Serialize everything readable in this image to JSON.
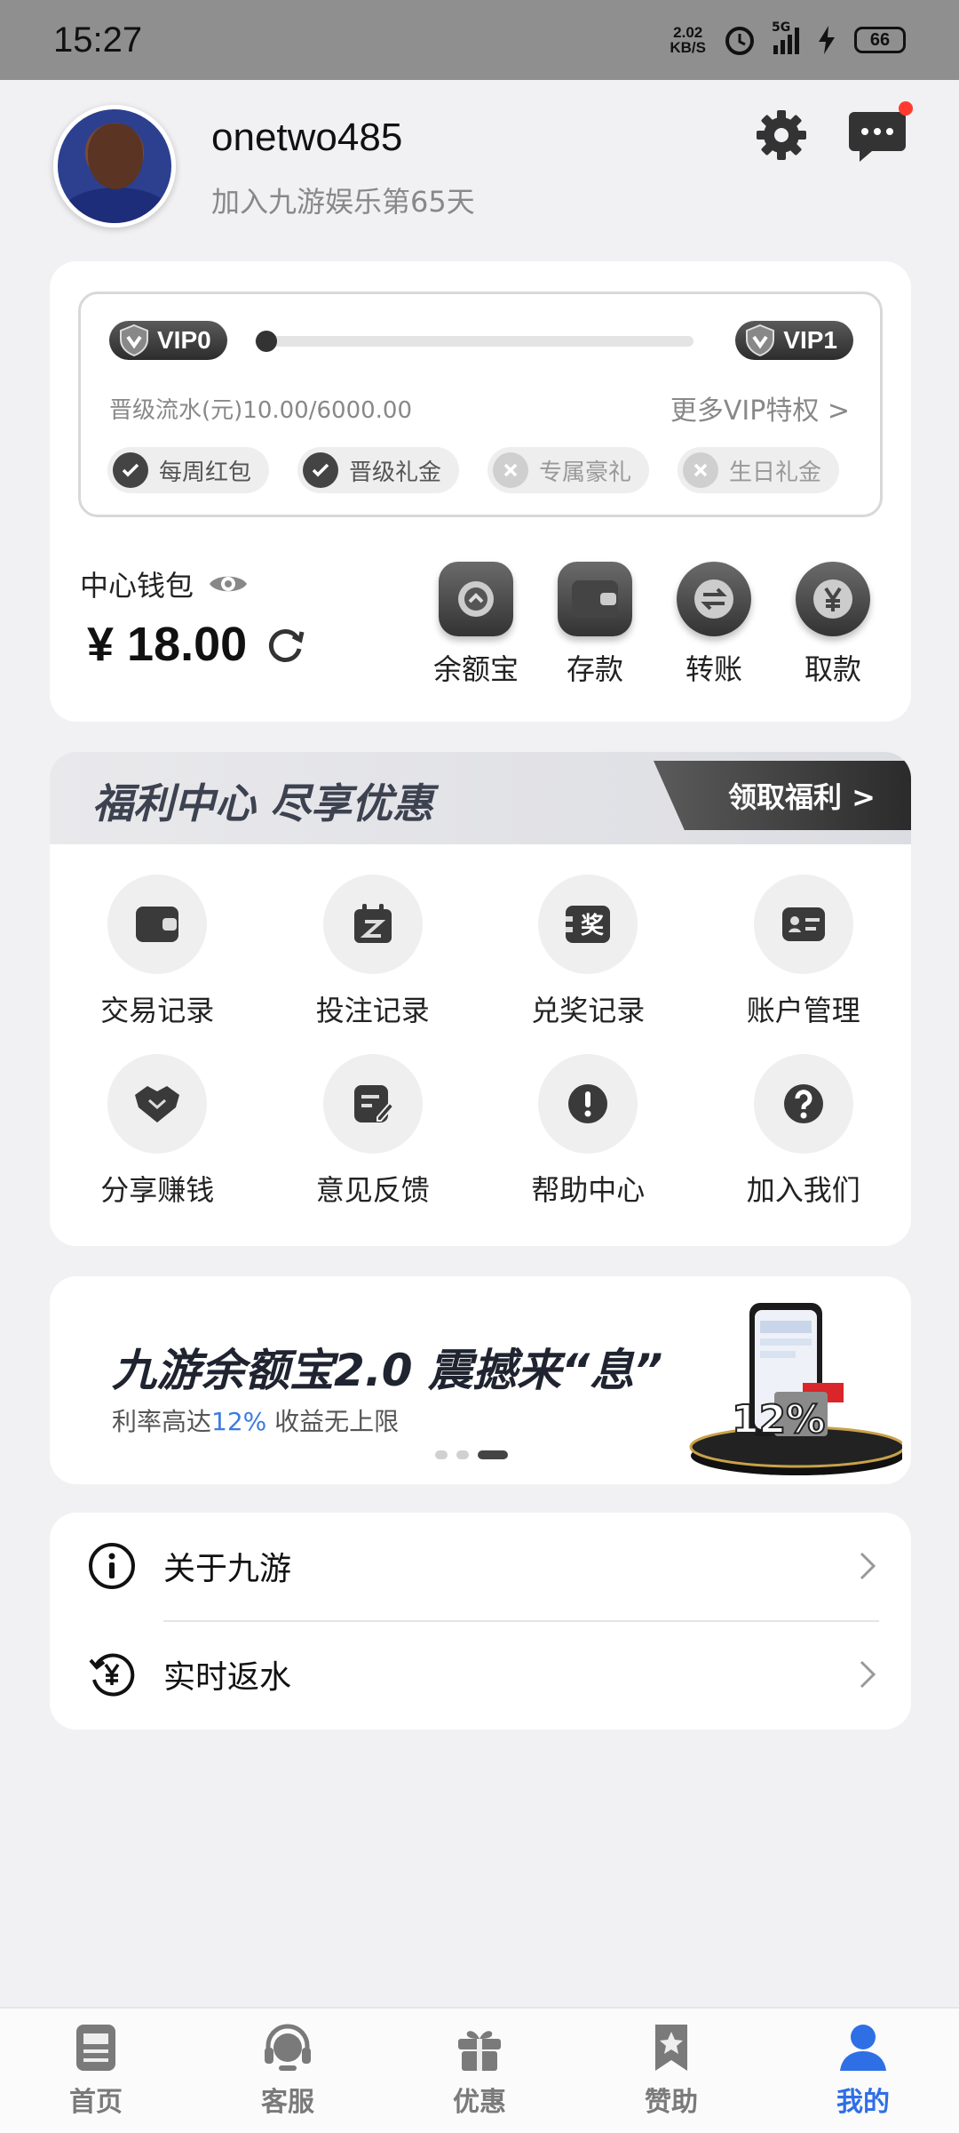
{
  "status_bar": {
    "time": "15:27",
    "net_speed": "2.02",
    "net_unit": "KB/S",
    "network": "5G",
    "battery": "66"
  },
  "profile": {
    "username": "onetwo485",
    "joined_text": "加入九游娱乐第65天"
  },
  "vip": {
    "current_level": "VIP0",
    "next_level": "VIP1",
    "progress_fraction": 0.0017,
    "progress_text": "晋级流水(元)10.00/6000.00",
    "more_link": "更多VIP特权 >",
    "perks": [
      {
        "label": "每周红包",
        "unlocked": true
      },
      {
        "label": "晋级礼金",
        "unlocked": true
      },
      {
        "label": "专属豪礼",
        "unlocked": false
      },
      {
        "label": "生日礼金",
        "unlocked": false
      }
    ]
  },
  "wallet": {
    "label": "中心钱包",
    "balance": "¥ 18.00",
    "actions": [
      {
        "label": "余额宝",
        "icon": "vault-icon"
      },
      {
        "label": "存款",
        "icon": "wallet-icon"
      },
      {
        "label": "转账",
        "icon": "transfer-icon"
      },
      {
        "label": "取款",
        "icon": "yen-icon"
      }
    ]
  },
  "welfare": {
    "title": "福利中心 尽享优惠",
    "claim_button": "领取福利 >",
    "items": [
      {
        "label": "交易记录",
        "icon": "wallet-icon"
      },
      {
        "label": "投注记录",
        "icon": "calendar-icon"
      },
      {
        "label": "兑奖记录",
        "icon": "prize-icon"
      },
      {
        "label": "账户管理",
        "icon": "id-card-icon"
      },
      {
        "label": "分享赚钱",
        "icon": "handshake-icon"
      },
      {
        "label": "意见反馈",
        "icon": "feedback-icon"
      },
      {
        "label": "帮助中心",
        "icon": "alert-icon"
      },
      {
        "label": "加入我们",
        "icon": "question-icon"
      }
    ]
  },
  "banner": {
    "title": "九游余额宝2.0 震撼来“息”",
    "subtitle_prefix": "利率高达",
    "subtitle_highlight": "12%",
    "subtitle_suffix": " 收益无上限",
    "art_text": "12%",
    "slide_count": 3,
    "active_slide": 3
  },
  "menu": [
    {
      "label": "关于九游",
      "icon": "info-icon"
    },
    {
      "label": "实时返水",
      "icon": "rebate-icon"
    }
  ],
  "tabbar": {
    "active_index": 4,
    "tabs": [
      {
        "label": "首页",
        "icon": "home-icon"
      },
      {
        "label": "客服",
        "icon": "headset-icon"
      },
      {
        "label": "优惠",
        "icon": "gift-icon"
      },
      {
        "label": "赞助",
        "icon": "star-bookmark-icon"
      },
      {
        "label": "我的",
        "icon": "user-icon"
      }
    ]
  },
  "colors": {
    "accent": "#2f6fe6",
    "dark": "#333333",
    "background": "#f1f1f3",
    "badge_red": "#ff3b30"
  }
}
